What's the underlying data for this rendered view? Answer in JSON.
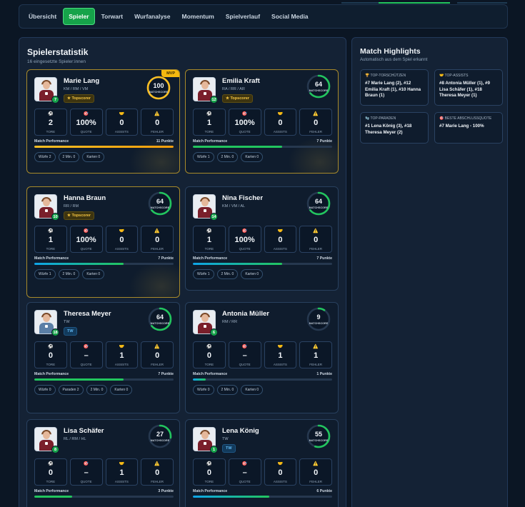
{
  "nav": {
    "tabs": [
      "Übersicht",
      "Spieler",
      "Torwart",
      "Wurfanalyse",
      "Momentum",
      "Spielverlauf",
      "Social Media"
    ],
    "active": "Spieler"
  },
  "players_panel": {
    "title": "Spielerstatistik",
    "subtitle": "16 eingesetzte Spieler:innen"
  },
  "labels": {
    "tore": "TORE",
    "quote": "QUOTE",
    "assists": "ASSISTS",
    "fehler": "FEHLER",
    "matchscore": "MATCHSCORE",
    "performance": "Match Performance",
    "topscorer": "★ Topscorer",
    "mvp": "MVP"
  },
  "players": [
    {
      "name": "Marie Lang",
      "number": "7",
      "pos": "KM / RM / VM",
      "badge": "★ Topscorer",
      "badge_type": "top",
      "score": "100",
      "score_pct": 100,
      "mvp": true,
      "gold": true,
      "tore": "2",
      "quote": "100%",
      "assists": "0",
      "fehler": "0",
      "points": "11 Punkte",
      "perf_pct": 100,
      "bar": "gold",
      "shirt": "red",
      "chips": [
        "Würfe 2",
        "2 Min. 0",
        "Karten 0"
      ]
    },
    {
      "name": "Emilia Kraft",
      "number": "12",
      "pos": "RA / RR / AR",
      "badge": "★ Topscorer",
      "badge_type": "top",
      "score": "64",
      "score_pct": 64,
      "mvp": false,
      "gold": true,
      "tore": "1",
      "quote": "100%",
      "assists": "0",
      "fehler": "0",
      "points": "7 Punkte",
      "perf_pct": 64,
      "bar": "green",
      "shirt": "red",
      "chips": [
        "Würfe 1",
        "2 Min. 0",
        "Karten 0"
      ]
    },
    {
      "name": "Hanna Braun",
      "number": "10",
      "pos": "RR / RM",
      "badge": "★ Topscorer",
      "badge_type": "top",
      "score": "64",
      "score_pct": 64,
      "mvp": false,
      "gold": true,
      "tore": "1",
      "quote": "100%",
      "assists": "0",
      "fehler": "0",
      "points": "7 Punkte",
      "perf_pct": 64,
      "bar": "teal",
      "shirt": "red",
      "chips": [
        "Würfe 1",
        "2 Min. 0",
        "Karten 0"
      ]
    },
    {
      "name": "Nina Fischer",
      "number": "14",
      "pos": "KM / VM / AL",
      "badge": "",
      "badge_type": "",
      "score": "64",
      "score_pct": 64,
      "mvp": false,
      "gold": false,
      "tore": "1",
      "quote": "100%",
      "assists": "0",
      "fehler": "0",
      "points": "7 Punkte",
      "perf_pct": 64,
      "bar": "teal",
      "shirt": "red",
      "chips": [
        "Würfe 1",
        "2 Min. 0",
        "Karten 0"
      ]
    },
    {
      "name": "Theresa Meyer",
      "number": "18",
      "pos": "TW",
      "badge": "TW",
      "badge_type": "tw",
      "score": "64",
      "score_pct": 64,
      "mvp": false,
      "gold": false,
      "tore": "0",
      "quote": "–",
      "assists": "1",
      "fehler": "0",
      "points": "7 Punkte",
      "perf_pct": 64,
      "bar": "green",
      "shirt": "blue",
      "chips": [
        "Würfe 0",
        "Paraden 2",
        "2 Min. 0",
        "Karten 0"
      ]
    },
    {
      "name": "Antonia Müller",
      "number": "6",
      "pos": "RM / RR",
      "badge": "",
      "badge_type": "",
      "score": "9",
      "score_pct": 9,
      "mvp": false,
      "gold": false,
      "tore": "0",
      "quote": "–",
      "assists": "1",
      "fehler": "1",
      "points": "1 Punkte",
      "perf_pct": 9,
      "bar": "teal",
      "shirt": "red",
      "chips": [
        "Würfe 0",
        "2 Min. 0",
        "Karten 0"
      ]
    },
    {
      "name": "Lisa Schäfer",
      "number": "8",
      "pos": "RL / RM / HL",
      "badge": "",
      "badge_type": "",
      "score": "27",
      "score_pct": 27,
      "mvp": false,
      "gold": false,
      "tore": "0",
      "quote": "–",
      "assists": "1",
      "fehler": "0",
      "points": "3 Punkte",
      "perf_pct": 27,
      "bar": "green",
      "shirt": "red",
      "chips": []
    },
    {
      "name": "Lena König",
      "number": "1",
      "pos": "TW",
      "badge": "TW",
      "badge_type": "tw",
      "score": "55",
      "score_pct": 55,
      "mvp": false,
      "gold": false,
      "tore": "0",
      "quote": "–",
      "assists": "0",
      "fehler": "0",
      "points": "6 Punkte",
      "perf_pct": 55,
      "bar": "teal",
      "shirt": "red",
      "chips": []
    }
  ],
  "highlights_panel": {
    "title": "Match Highlights",
    "subtitle": "Automatisch aus dem Spiel erkannt",
    "items": [
      {
        "icon": "trophy-icon",
        "glyph": "🏆",
        "title": "TOP-TORSCHÜTZEN",
        "value": "#7 Marie Lang (2), #12 Emilia Kraft (1), #10 Hanna Braun (1)"
      },
      {
        "icon": "handshake-icon",
        "glyph": "🤝",
        "title": "TOP-ASSISTS",
        "value": "#8 Antonia Müller (1), #9 Lisa Schäfer (1), #18 Theresa Meyer (1)"
      },
      {
        "icon": "glove-icon",
        "glyph": "🧤",
        "title": "TOP-PARADEN",
        "value": "#1 Lena König (3), #18 Theresa Meyer (2)"
      },
      {
        "icon": "target-icon",
        "glyph": "🎯",
        "title": "BESTE ABSCHLUSSQUOTE",
        "value": "#7 Marie Lang - 100%"
      }
    ]
  },
  "colors": {
    "accent": "#22c55e",
    "gold": "#f5b90f",
    "bg": "#0b1624",
    "card": "#0f1c2d"
  }
}
